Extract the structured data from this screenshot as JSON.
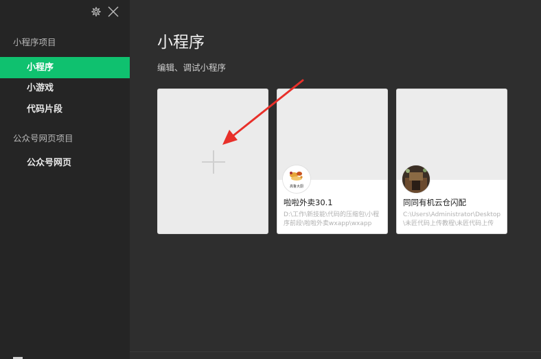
{
  "sidebar": {
    "icons": {
      "settings": "gear-icon",
      "close": "close-icon"
    },
    "sections": [
      {
        "title": "小程序项目",
        "items": [
          {
            "label": "小程序",
            "active": true
          },
          {
            "label": "小游戏",
            "active": false
          },
          {
            "label": "代码片段",
            "active": false
          }
        ]
      },
      {
        "title": "公众号网页项目",
        "items": [
          {
            "label": "公众号网页",
            "active": false
          }
        ]
      }
    ]
  },
  "main": {
    "title": "小程序",
    "subtitle": "编辑、调试小程序",
    "new_card_icon": "plus-icon",
    "projects": [
      {
        "name": "啦啦外卖30.1",
        "path": "D:\\工作\\新技能\\代码的压缩包\\小程序前段\\啦啦外卖wxapp\\wxapp",
        "avatar_text": "高鲁大厨"
      },
      {
        "name": "同同有机云仓闪配",
        "path": "C:\\Users\\Administrator\\Desktop\\未匠代码上传教程\\未匠代码上传",
        "avatar_text": ""
      }
    ]
  },
  "colors": {
    "accent": "#0fc16f",
    "sidebar_bg": "#252525",
    "main_bg": "#2e2e2e",
    "annotation_arrow": "#e8302a"
  }
}
